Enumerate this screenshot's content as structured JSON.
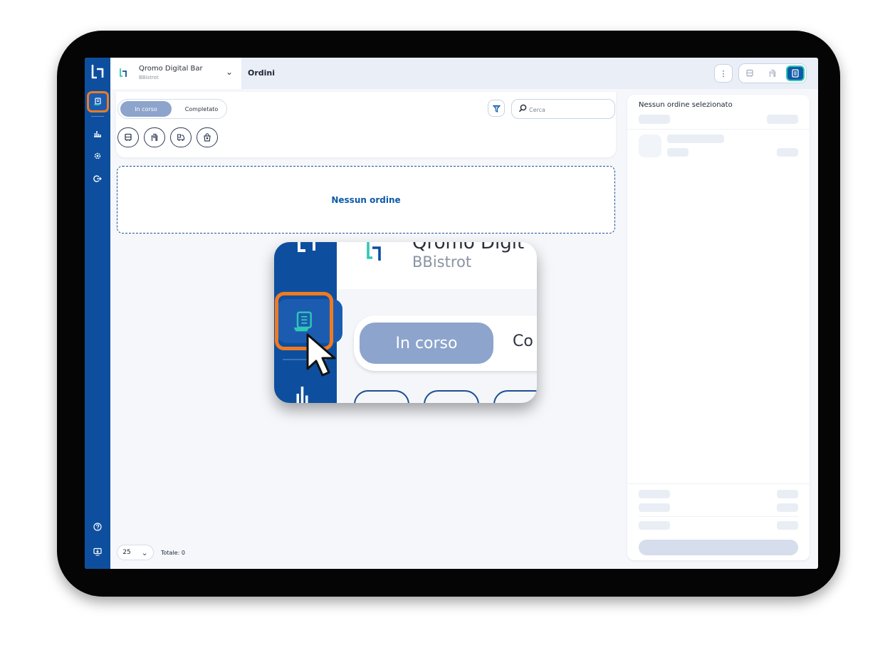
{
  "app": {
    "venue_name": "Qromo Digital Bar",
    "venue_sub": "BBistrot",
    "page_title": "Ordini"
  },
  "rail": {
    "items": [
      {
        "icon": "orders-icon",
        "active": true
      },
      {
        "icon": "stats-icon"
      },
      {
        "icon": "settings-icon"
      },
      {
        "icon": "logout-icon"
      }
    ],
    "bottom": [
      {
        "icon": "help-icon"
      },
      {
        "icon": "monitor-icon"
      }
    ]
  },
  "view_switch": {
    "items": [
      {
        "icon": "table-icon"
      },
      {
        "icon": "counter-icon"
      },
      {
        "icon": "list-icon",
        "active": true
      }
    ]
  },
  "filters": {
    "status_active": "In corso",
    "status_inactive": "Completato",
    "type_icons": [
      "table-icon",
      "counter-icon",
      "delivery-icon",
      "takeaway-icon"
    ],
    "search_placeholder": "Cerca"
  },
  "orders": {
    "empty_message": "Nessun ordine"
  },
  "pagination": {
    "page_size": "25",
    "total": "Totale: 0"
  },
  "detail": {
    "title": "Nessun ordine selezionato"
  },
  "zoom": {
    "venue_name": "Qromo Digit",
    "venue_sub": "BBistrot",
    "status_active": "In corso",
    "status_inactive": "Co"
  },
  "colors": {
    "brand_blue": "#0d4f9e",
    "accent_teal": "#2fc8b5",
    "highlight_orange": "#f07a21",
    "pill_active": "#8da4cc"
  }
}
